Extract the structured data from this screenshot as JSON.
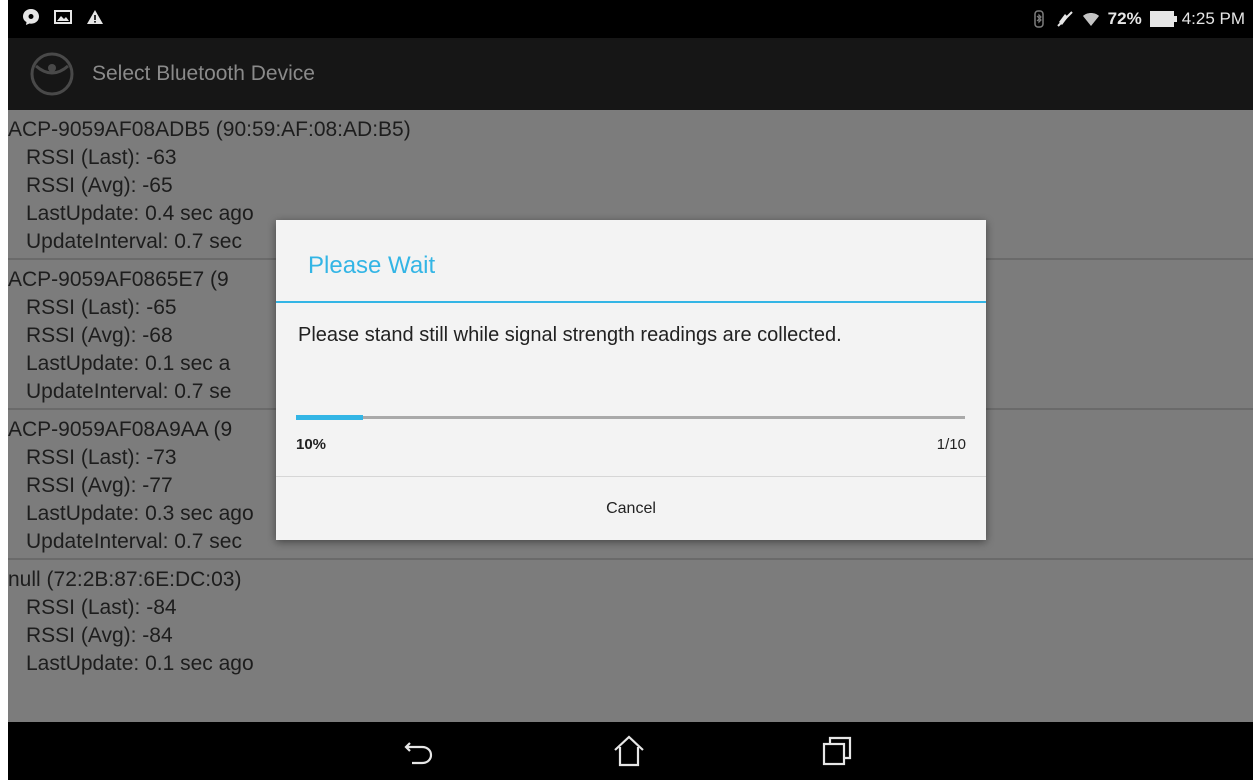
{
  "status_bar": {
    "battery_percent": "72%",
    "time": "4:25 PM",
    "icons": [
      "messenger-icon",
      "image-icon",
      "warning-icon",
      "bluetooth-icon",
      "no-sound-icon",
      "wifi-icon",
      "battery-icon"
    ]
  },
  "action_bar": {
    "title": "Select Bluetooth Device"
  },
  "devices": [
    {
      "name": "ACP-9059AF08ADB5 (90:59:AF:08:AD:B5)",
      "rssi_last": "RSSI (Last): -63",
      "rssi_avg": "RSSI (Avg): -65",
      "last_update": "LastUpdate: 0.4 sec ago",
      "update_interval": "UpdateInterval: 0.7 sec"
    },
    {
      "name": "ACP-9059AF0865E7 (9",
      "rssi_last": "RSSI (Last): -65",
      "rssi_avg": "RSSI (Avg): -68",
      "last_update": "LastUpdate: 0.1 sec a",
      "update_interval": "UpdateInterval: 0.7 se"
    },
    {
      "name": "ACP-9059AF08A9AA (9",
      "rssi_last": "RSSI (Last): -73",
      "rssi_avg": "RSSI (Avg): -77",
      "last_update": "LastUpdate: 0.3 sec ago",
      "update_interval": "UpdateInterval: 0.7 sec"
    },
    {
      "name": "null (72:2B:87:6E:DC:03)",
      "rssi_last": "RSSI (Last): -84",
      "rssi_avg": "RSSI (Avg): -84",
      "last_update": "LastUpdate: 0.1 sec ago",
      "update_interval": ""
    }
  ],
  "dialog": {
    "title": "Please Wait",
    "message": "Please stand still while signal strength readings are collected.",
    "progress_fraction": 0.1,
    "progress_percent_label": "10%",
    "progress_count_label": "1/10",
    "cancel_label": "Cancel"
  },
  "colors": {
    "accent": "#33b5e5",
    "dim_background": "#7c7c7c"
  }
}
